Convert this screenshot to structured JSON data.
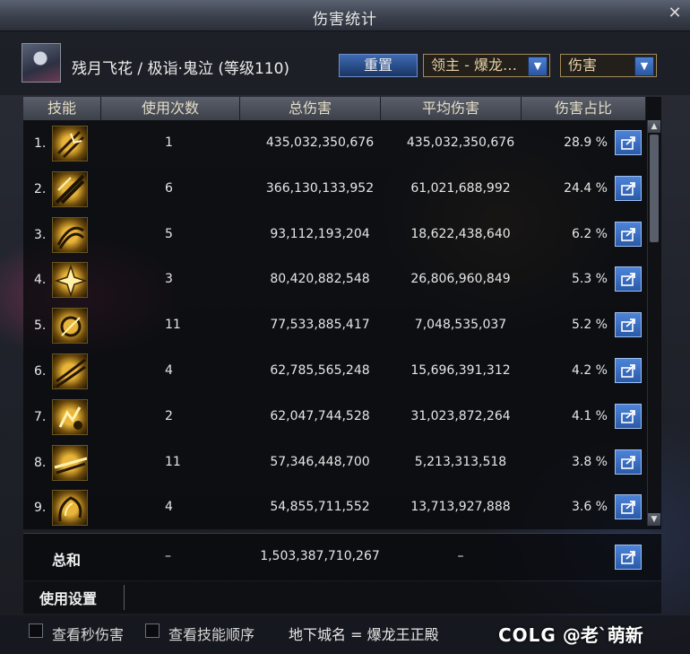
{
  "window": {
    "title": "伤害统计",
    "close": "✕"
  },
  "character": {
    "name": "残月飞花 / 极诣·鬼泣 (等级110)"
  },
  "controls": {
    "reset_label": "重置",
    "boss_select": "领主 - 爆龙…",
    "type_select": "伤害",
    "dropdown_arrow": "▼"
  },
  "columns": [
    "技能",
    "使用次数",
    "总伤害",
    "平均伤害",
    "伤害占比"
  ],
  "rows": [
    {
      "rank": "1.",
      "uses": "1",
      "total": "435,032,350,676",
      "avg": "435,032,350,676",
      "pct": "28.9 %"
    },
    {
      "rank": "2.",
      "uses": "6",
      "total": "366,130,133,952",
      "avg": "61,021,688,992",
      "pct": "24.4 %"
    },
    {
      "rank": "3.",
      "uses": "5",
      "total": "93,112,193,204",
      "avg": "18,622,438,640",
      "pct": "6.2 %"
    },
    {
      "rank": "4.",
      "uses": "3",
      "total": "80,420,882,548",
      "avg": "26,806,960,849",
      "pct": "5.3 %"
    },
    {
      "rank": "5.",
      "uses": "11",
      "total": "77,533,885,417",
      "avg": "7,048,535,037",
      "pct": "5.2 %"
    },
    {
      "rank": "6.",
      "uses": "4",
      "total": "62,785,565,248",
      "avg": "15,696,391,312",
      "pct": "4.2 %"
    },
    {
      "rank": "7.",
      "uses": "2",
      "total": "62,047,744,528",
      "avg": "31,023,872,264",
      "pct": "4.1 %"
    },
    {
      "rank": "8.",
      "uses": "11",
      "total": "57,346,448,700",
      "avg": "5,213,313,518",
      "pct": "3.8 %"
    },
    {
      "rank": "9.",
      "uses": "4",
      "total": "54,855,711,552",
      "avg": "13,713,927,888",
      "pct": "3.6 %"
    }
  ],
  "summary": {
    "label": "总和",
    "uses": "–",
    "total": "1,503,387,710,267",
    "avg": "–"
  },
  "settings": {
    "label": "使用设置"
  },
  "footer": {
    "check_dps": "查看秒伤害",
    "check_order": "查看技能顺序",
    "dungeon": "地下城名 = 爆龙王正殿"
  },
  "watermark": {
    "logo": "COLG",
    "handle": "@老`萌新"
  },
  "colors": {
    "accent_blue": "#2f63b5",
    "gold": "#e8b43a"
  },
  "icons": {
    "share": "share-icon",
    "close": "close-icon",
    "dropdown": "chevron-down-icon"
  }
}
